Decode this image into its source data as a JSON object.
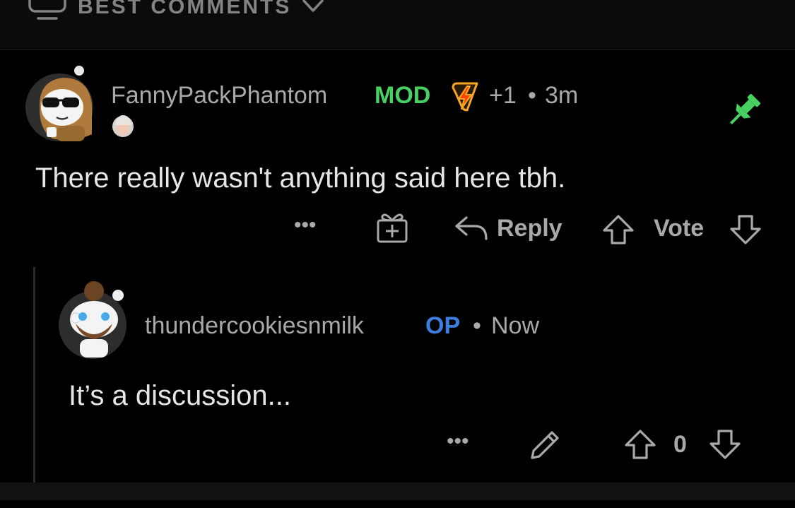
{
  "sort": {
    "label": "BEST COMMENTS",
    "icon": "comments-sort-icon"
  },
  "comments": [
    {
      "author": "FannyPackPhantom",
      "mod_badge": "MOD",
      "award_icon": "lightning-award-icon",
      "karma": "+1",
      "separator": "•",
      "time": "3m",
      "body": "There really wasn't anything said here tbh.",
      "pinned": true,
      "actions": {
        "more": "•••",
        "reply": "Reply",
        "vote": "Vote"
      },
      "colors": {
        "mod": "#46d160",
        "pin": "#46d160",
        "award": "#f5a623"
      }
    },
    {
      "author": "thundercookiesnmilk",
      "op_badge": "OP",
      "separator": "•",
      "time": "Now",
      "body": "It’s a discussion...",
      "actions": {
        "more": "•••",
        "score": "0"
      },
      "colors": {
        "op": "#3d7fe0"
      }
    }
  ]
}
